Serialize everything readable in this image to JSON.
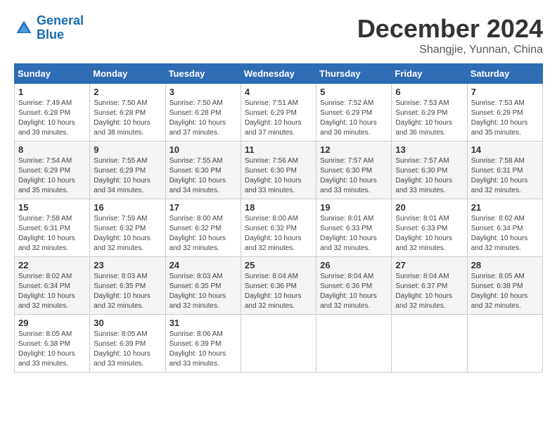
{
  "logo": {
    "line1": "General",
    "line2": "Blue"
  },
  "title": "December 2024",
  "location": "Shangjie, Yunnan, China",
  "weekdays": [
    "Sunday",
    "Monday",
    "Tuesday",
    "Wednesday",
    "Thursday",
    "Friday",
    "Saturday"
  ],
  "weeks": [
    [
      {
        "day": "1",
        "info": "Sunrise: 7:49 AM\nSunset: 6:28 PM\nDaylight: 10 hours\nand 39 minutes."
      },
      {
        "day": "2",
        "info": "Sunrise: 7:50 AM\nSunset: 6:28 PM\nDaylight: 10 hours\nand 38 minutes."
      },
      {
        "day": "3",
        "info": "Sunrise: 7:50 AM\nSunset: 6:28 PM\nDaylight: 10 hours\nand 37 minutes."
      },
      {
        "day": "4",
        "info": "Sunrise: 7:51 AM\nSunset: 6:29 PM\nDaylight: 10 hours\nand 37 minutes."
      },
      {
        "day": "5",
        "info": "Sunrise: 7:52 AM\nSunset: 6:29 PM\nDaylight: 10 hours\nand 36 minutes."
      },
      {
        "day": "6",
        "info": "Sunrise: 7:53 AM\nSunset: 6:29 PM\nDaylight: 10 hours\nand 36 minutes."
      },
      {
        "day": "7",
        "info": "Sunrise: 7:53 AM\nSunset: 6:29 PM\nDaylight: 10 hours\nand 35 minutes."
      }
    ],
    [
      {
        "day": "8",
        "info": "Sunrise: 7:54 AM\nSunset: 6:29 PM\nDaylight: 10 hours\nand 35 minutes."
      },
      {
        "day": "9",
        "info": "Sunrise: 7:55 AM\nSunset: 6:29 PM\nDaylight: 10 hours\nand 34 minutes."
      },
      {
        "day": "10",
        "info": "Sunrise: 7:55 AM\nSunset: 6:30 PM\nDaylight: 10 hours\nand 34 minutes."
      },
      {
        "day": "11",
        "info": "Sunrise: 7:56 AM\nSunset: 6:30 PM\nDaylight: 10 hours\nand 33 minutes."
      },
      {
        "day": "12",
        "info": "Sunrise: 7:57 AM\nSunset: 6:30 PM\nDaylight: 10 hours\nand 33 minutes."
      },
      {
        "day": "13",
        "info": "Sunrise: 7:57 AM\nSunset: 6:30 PM\nDaylight: 10 hours\nand 33 minutes."
      },
      {
        "day": "14",
        "info": "Sunrise: 7:58 AM\nSunset: 6:31 PM\nDaylight: 10 hours\nand 32 minutes."
      }
    ],
    [
      {
        "day": "15",
        "info": "Sunrise: 7:58 AM\nSunset: 6:31 PM\nDaylight: 10 hours\nand 32 minutes."
      },
      {
        "day": "16",
        "info": "Sunrise: 7:59 AM\nSunset: 6:32 PM\nDaylight: 10 hours\nand 32 minutes."
      },
      {
        "day": "17",
        "info": "Sunrise: 8:00 AM\nSunset: 6:32 PM\nDaylight: 10 hours\nand 32 minutes."
      },
      {
        "day": "18",
        "info": "Sunrise: 8:00 AM\nSunset: 6:32 PM\nDaylight: 10 hours\nand 32 minutes."
      },
      {
        "day": "19",
        "info": "Sunrise: 8:01 AM\nSunset: 6:33 PM\nDaylight: 10 hours\nand 32 minutes."
      },
      {
        "day": "20",
        "info": "Sunrise: 8:01 AM\nSunset: 6:33 PM\nDaylight: 10 hours\nand 32 minutes."
      },
      {
        "day": "21",
        "info": "Sunrise: 8:02 AM\nSunset: 6:34 PM\nDaylight: 10 hours\nand 32 minutes."
      }
    ],
    [
      {
        "day": "22",
        "info": "Sunrise: 8:02 AM\nSunset: 6:34 PM\nDaylight: 10 hours\nand 32 minutes."
      },
      {
        "day": "23",
        "info": "Sunrise: 8:03 AM\nSunset: 6:35 PM\nDaylight: 10 hours\nand 32 minutes."
      },
      {
        "day": "24",
        "info": "Sunrise: 8:03 AM\nSunset: 6:35 PM\nDaylight: 10 hours\nand 32 minutes."
      },
      {
        "day": "25",
        "info": "Sunrise: 8:04 AM\nSunset: 6:36 PM\nDaylight: 10 hours\nand 32 minutes."
      },
      {
        "day": "26",
        "info": "Sunrise: 8:04 AM\nSunset: 6:36 PM\nDaylight: 10 hours\nand 32 minutes."
      },
      {
        "day": "27",
        "info": "Sunrise: 8:04 AM\nSunset: 6:37 PM\nDaylight: 10 hours\nand 32 minutes."
      },
      {
        "day": "28",
        "info": "Sunrise: 8:05 AM\nSunset: 6:38 PM\nDaylight: 10 hours\nand 32 minutes."
      }
    ],
    [
      {
        "day": "29",
        "info": "Sunrise: 8:05 AM\nSunset: 6:38 PM\nDaylight: 10 hours\nand 33 minutes."
      },
      {
        "day": "30",
        "info": "Sunrise: 8:05 AM\nSunset: 6:39 PM\nDaylight: 10 hours\nand 33 minutes."
      },
      {
        "day": "31",
        "info": "Sunrise: 8:06 AM\nSunset: 6:39 PM\nDaylight: 10 hours\nand 33 minutes."
      },
      {
        "day": "",
        "info": ""
      },
      {
        "day": "",
        "info": ""
      },
      {
        "day": "",
        "info": ""
      },
      {
        "day": "",
        "info": ""
      }
    ]
  ]
}
